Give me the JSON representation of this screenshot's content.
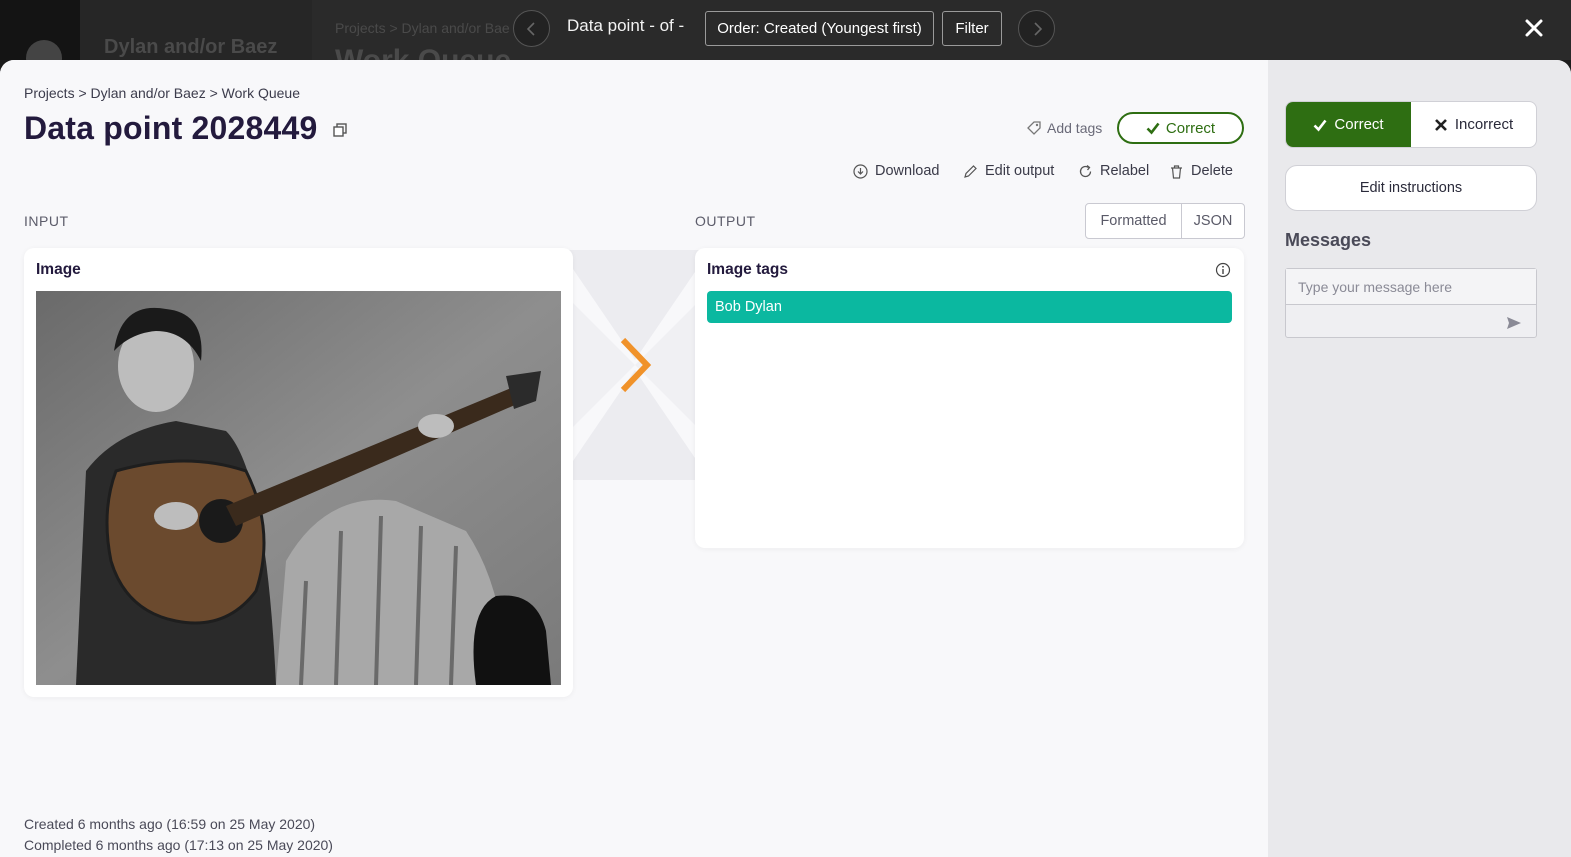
{
  "background": {
    "project_name": "Dylan and/or Baez",
    "breadcrumb": "Projects > Dylan and/or Bae",
    "title": "Work Queue"
  },
  "topbar": {
    "counter": "Data point - of -",
    "order_label": "Order: Created (Youngest first)",
    "filter_label": "Filter"
  },
  "header": {
    "breadcrumb": "Projects > Dylan and/or Baez > Work Queue",
    "title": "Data point 2028449",
    "add_tags_label": "Add tags",
    "status_label": "Correct"
  },
  "actions": {
    "download": "Download",
    "edit_output": "Edit output",
    "relabel": "Relabel",
    "delete": "Delete"
  },
  "input": {
    "section_label": "INPUT",
    "card_title": "Image"
  },
  "output": {
    "section_label": "OUTPUT",
    "view_formatted": "Formatted",
    "view_json": "JSON",
    "card_title": "Image tags",
    "tags": [
      "Bob Dylan"
    ]
  },
  "meta": {
    "created": "Created 6 months ago (16:59 on 25 May 2020)",
    "completed": "Completed 6 months ago (17:13 on 25 May 2020)"
  },
  "review": {
    "correct_label": "Correct",
    "incorrect_label": "Incorrect",
    "edit_instructions_label": "Edit instructions",
    "messages_title": "Messages",
    "message_placeholder": "Type your message here"
  },
  "colors": {
    "correct_green": "#2e6e12",
    "tag_teal": "#0bb8a0",
    "arrow_orange": "#f0922a"
  }
}
